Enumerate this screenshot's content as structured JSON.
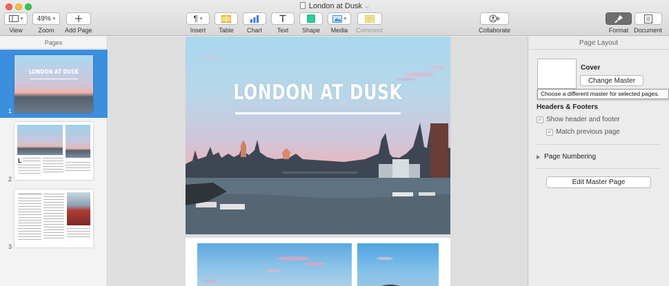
{
  "window": {
    "title": "London at Dusk"
  },
  "toolbar": {
    "view": {
      "label": "View"
    },
    "zoom": {
      "value": "49%",
      "label": "Zoom"
    },
    "add_page": {
      "label": "Add Page"
    },
    "insert": {
      "label": "Insert"
    },
    "table": {
      "label": "Table"
    },
    "chart": {
      "label": "Chart"
    },
    "text": {
      "label": "Text"
    },
    "shape": {
      "label": "Shape"
    },
    "media": {
      "label": "Media"
    },
    "comment": {
      "label": "Comment"
    },
    "collaborate": {
      "label": "Collaborate"
    },
    "format": {
      "label": "Format"
    },
    "document": {
      "label": "Document"
    }
  },
  "sidebar": {
    "title": "Pages",
    "pages": [
      {
        "number": "1",
        "selected": true,
        "thumb_title": "LONDON AT DUSK"
      },
      {
        "number": "2",
        "selected": false
      },
      {
        "number": "3",
        "selected": false
      }
    ]
  },
  "canvas": {
    "cover_title": "LONDON AT DUSK"
  },
  "inspector": {
    "title": "Page Layout",
    "master_name": "Cover",
    "change_master_label": "Change Master",
    "tooltip": "Choose a different master for selected pages.",
    "headers_footers_title": "Headers & Footers",
    "show_header_footer_label": "Show header and footer",
    "show_header_footer_checked": true,
    "match_previous_label": "Match previous page",
    "match_previous_checked": true,
    "page_numbering_label": "Page Numbering",
    "edit_master_label": "Edit Master Page"
  },
  "colors": {
    "selection_blue": "#3b8fde",
    "close": "#fc605c",
    "minimize": "#fdbc40",
    "maximize": "#34c84a",
    "table_icon": "#f5c94a",
    "chart_icon": "#3d7ddb",
    "shape_icon": "#2ecc9a",
    "media_icon": "#4a90d9",
    "comment_icon": "#f2e39a"
  }
}
